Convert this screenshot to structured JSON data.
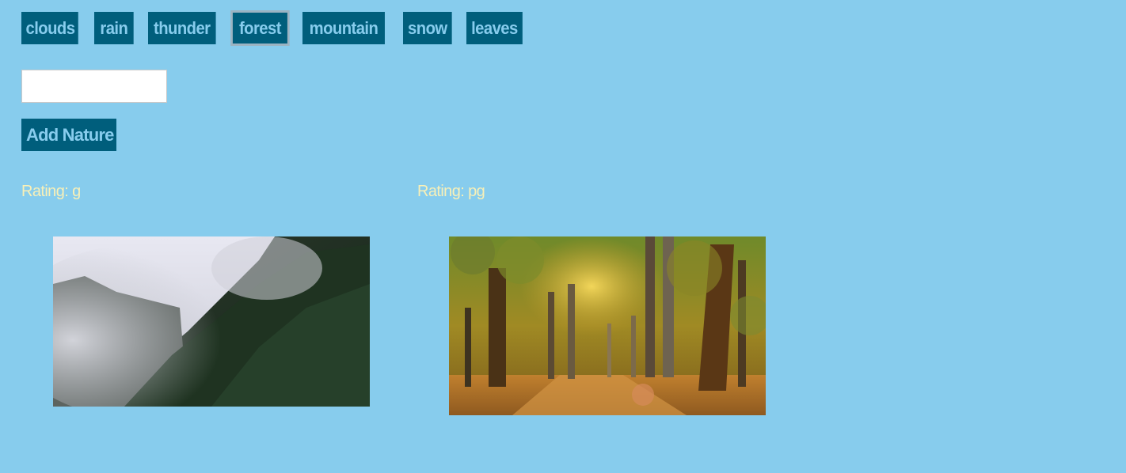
{
  "topics": [
    {
      "label": "clouds"
    },
    {
      "label": "rain"
    },
    {
      "label": "thunder"
    },
    {
      "label": "forest"
    },
    {
      "label": "mountain"
    },
    {
      "label": "snow"
    },
    {
      "label": "leaves"
    }
  ],
  "form": {
    "input_value": "",
    "input_placeholder": "",
    "add_label": "Add Nature"
  },
  "results": [
    {
      "rating": "Rating: g",
      "image": "misty forest hillside"
    },
    {
      "rating": "Rating: pg",
      "image": "autumn forest path"
    }
  ],
  "colors": {
    "background": "#87cced",
    "button_bg": "#005e7c",
    "button_text": "#87cced",
    "rating_text": "#f8f0b8"
  }
}
